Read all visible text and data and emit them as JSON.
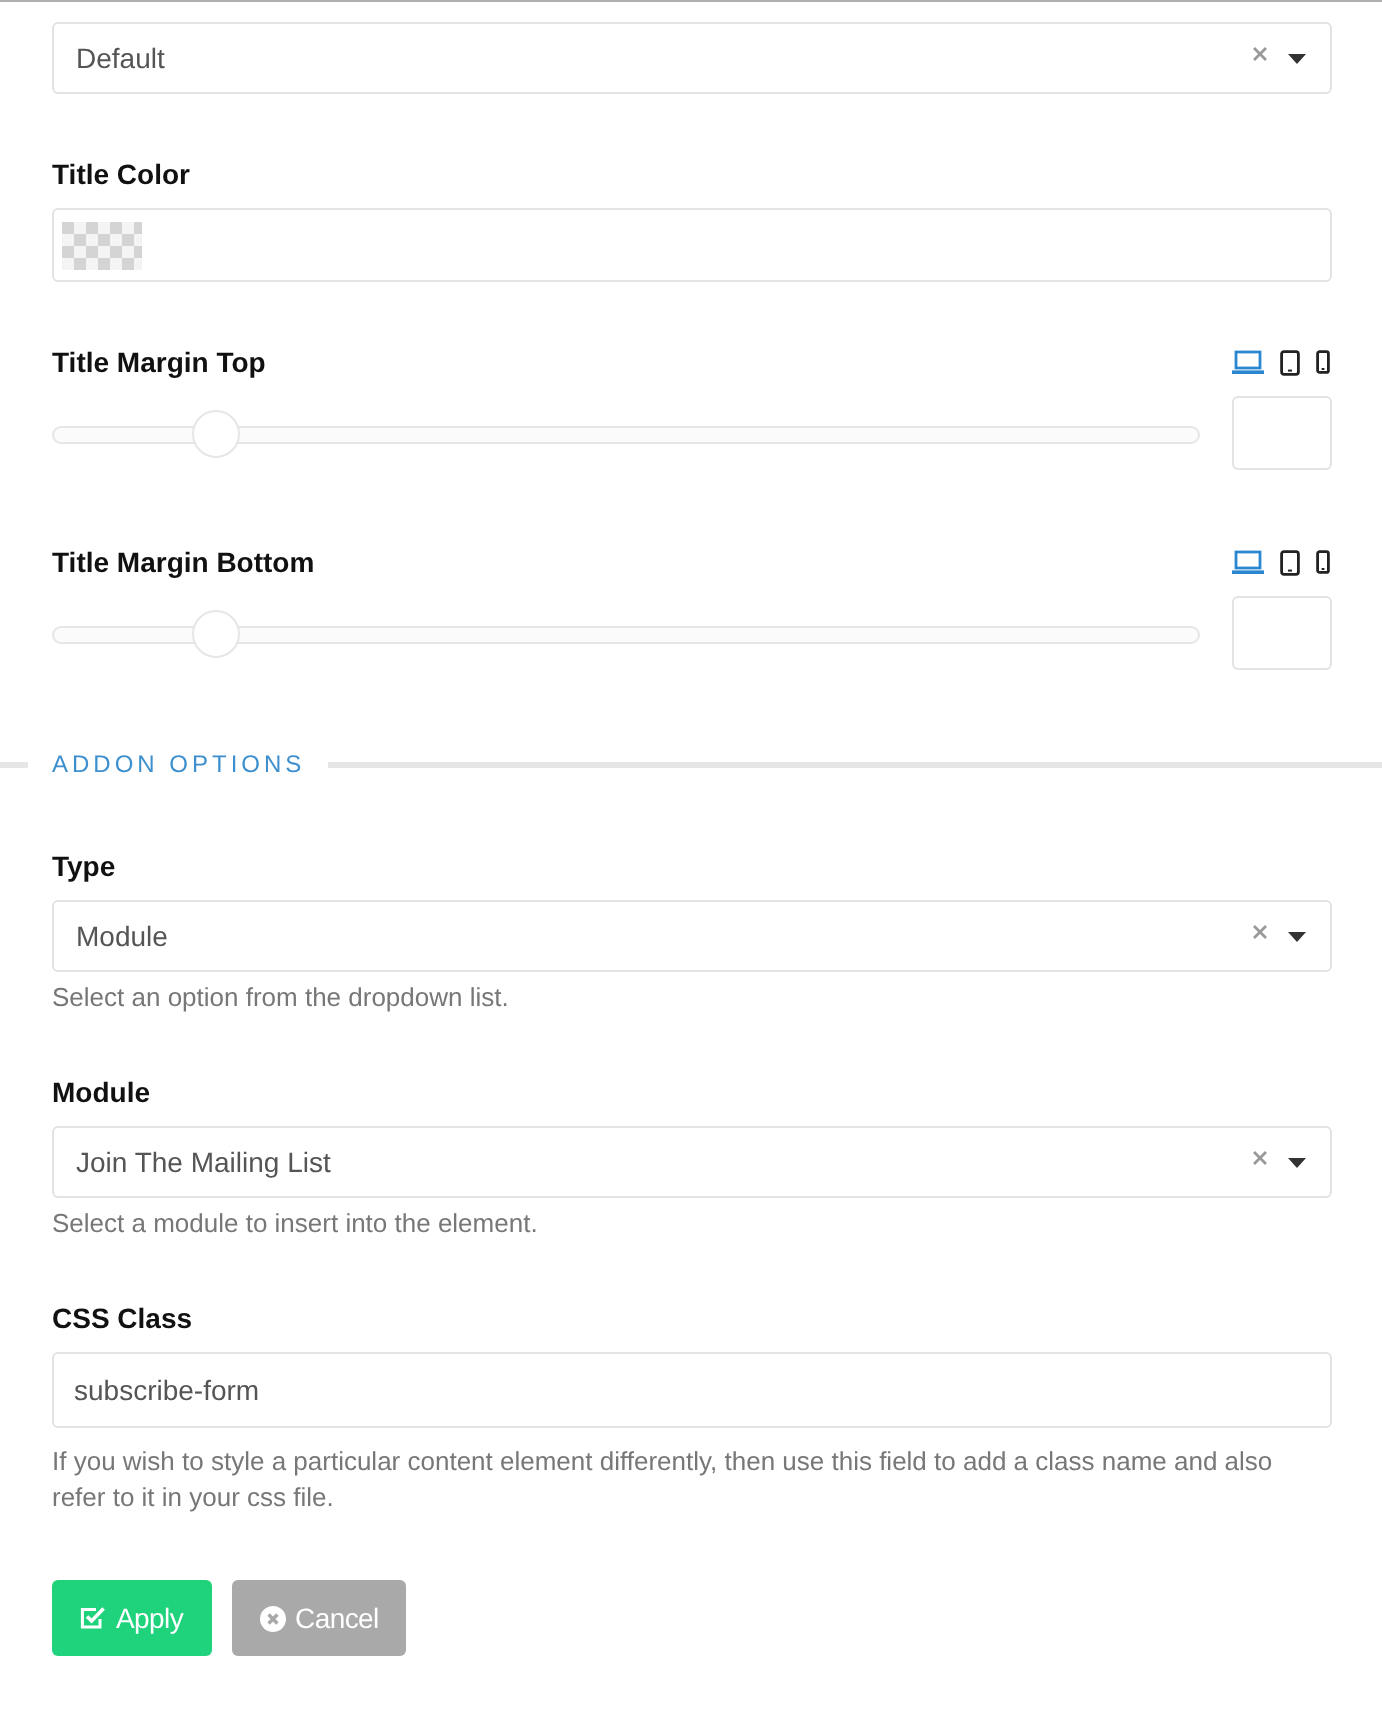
{
  "fields": [
    {
      "kind": "select",
      "value": "Default"
    },
    {
      "kind": "color",
      "label": "Title Color"
    },
    {
      "kind": "slider",
      "label": "Title Margin Top",
      "level": 0.143,
      "devices": [
        {
          "kind": "laptop",
          "selected": true
        },
        {
          "kind": "tablet",
          "selected": false
        },
        {
          "kind": "phone",
          "selected": false
        }
      ]
    },
    {
      "kind": "slider",
      "label": "Title Margin Bottom",
      "level": 0.143,
      "devices": [
        {
          "kind": "laptop",
          "selected": true
        },
        {
          "kind": "tablet",
          "selected": false
        },
        {
          "kind": "phone",
          "selected": false
        }
      ]
    },
    {
      "kind": "section",
      "title": "ADDON OPTIONS"
    },
    {
      "kind": "select",
      "label": "Type",
      "value": "Module",
      "help": "Select an option from the dropdown list."
    },
    {
      "kind": "select",
      "label": "Module",
      "value": "Join The Mailing List",
      "help": "Select a module to insert into the element."
    },
    {
      "kind": "text",
      "label": "CSS Class",
      "value": "subscribe-form",
      "help": "If you wish to style a particular content element differently, then use this field to add a class name and also refer to it in your css file."
    }
  ],
  "buttons": [
    {
      "kind": "apply",
      "label": "Apply"
    },
    {
      "kind": "cancel",
      "label": "Cancel"
    }
  ]
}
